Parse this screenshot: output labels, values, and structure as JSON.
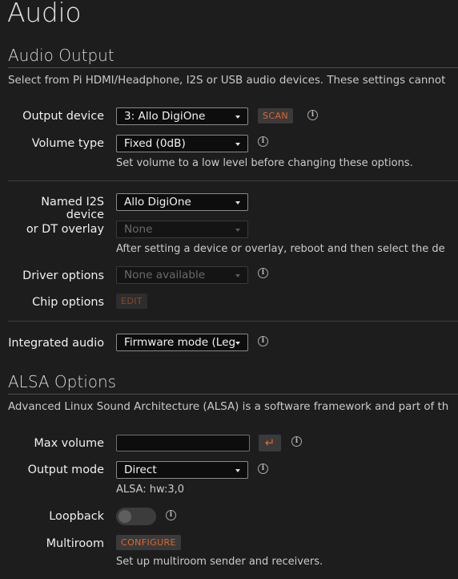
{
  "page": {
    "title": "Audio"
  },
  "audio_output": {
    "title": "Audio Output",
    "description": "Select from Pi HDMI/Headphone, I2S or USB audio devices. These settings cannot",
    "output_device": {
      "label": "Output device",
      "value": "3: Allo DigiOne",
      "scan_label": "SCAN"
    },
    "volume_type": {
      "label": "Volume type",
      "value": "Fixed (0dB)",
      "help": "Set volume to a low level before changing these options."
    },
    "named_i2s": {
      "label_line1": "Named I2S",
      "label_line2": "device",
      "label_line3": "or DT overlay",
      "value": "Allo DigiOne",
      "overlay_value": "None",
      "help": "After setting a device or overlay, reboot and then select the de"
    },
    "driver_options": {
      "label": "Driver options",
      "value": "None available"
    },
    "chip_options": {
      "label": "Chip options",
      "edit_label": "EDIT"
    },
    "integrated_audio": {
      "label": "Integrated audio",
      "value": "Firmware mode (Leg"
    }
  },
  "alsa_options": {
    "title": "ALSA Options",
    "description": "Advanced Linux Sound Architecture (ALSA) is a software framework and part of th",
    "max_volume": {
      "label": "Max volume",
      "value": "",
      "enter_icon": "enter-arrow-icon"
    },
    "output_mode": {
      "label": "Output mode",
      "value": "Direct",
      "help": "ALSA: hw:3,0"
    },
    "loopback": {
      "label": "Loopback",
      "enabled": false
    },
    "multiroom": {
      "label": "Multiroom",
      "configure_label": "CONFIGURE",
      "help": "Set up multiroom sender and receivers."
    }
  },
  "icons": {
    "info": "info-circle-icon",
    "caret": "caret-down-icon",
    "enter": "enter-arrow-icon"
  },
  "colors": {
    "background": "#1d1d1d",
    "accent": "#e0662a",
    "button_bg": "#3a3a3a"
  }
}
